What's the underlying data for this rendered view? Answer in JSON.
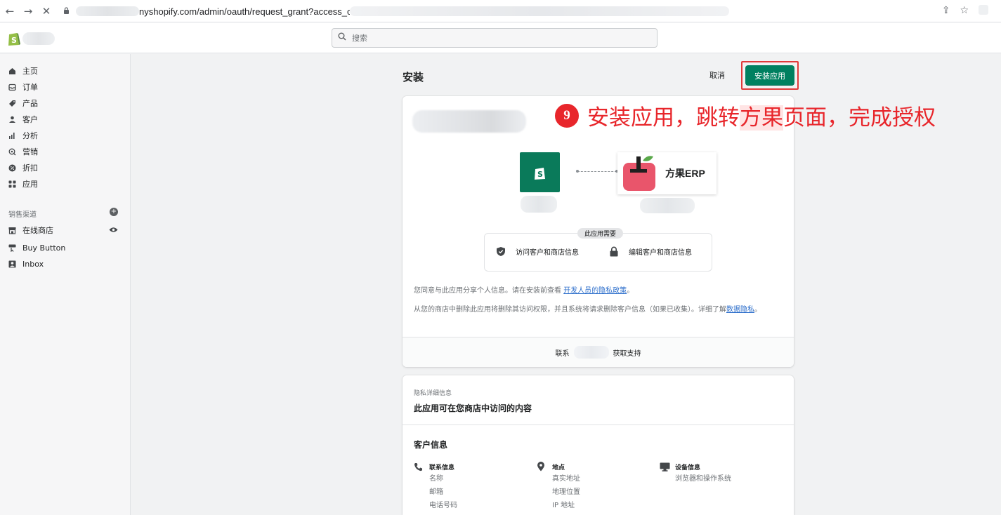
{
  "browser": {
    "url_visible": "nyshopify.com/admin/oauth/request_grant?access_change"
  },
  "topbar": {
    "search_placeholder": "搜索"
  },
  "sidebar": {
    "items": [
      {
        "label": "主页",
        "icon": "home-icon"
      },
      {
        "label": "订单",
        "icon": "inbox-tray-icon"
      },
      {
        "label": "产品",
        "icon": "tag-icon"
      },
      {
        "label": "客户",
        "icon": "person-icon"
      },
      {
        "label": "分析",
        "icon": "bar-chart-icon"
      },
      {
        "label": "营销",
        "icon": "target-icon"
      },
      {
        "label": "折扣",
        "icon": "discount-icon"
      },
      {
        "label": "应用",
        "icon": "apps-icon"
      }
    ],
    "channels_label": "销售渠道",
    "channels": [
      {
        "label": "在线商店",
        "icon": "storefront-icon"
      },
      {
        "label": "Buy Button",
        "icon": "buy-button-icon"
      },
      {
        "label": "Inbox",
        "icon": "inbox-icon"
      }
    ]
  },
  "page": {
    "title": "安装",
    "cancel_label": "取消",
    "install_label": "安装应用"
  },
  "card": {
    "app_tile_name": "方果ERP",
    "requirements_label": "此应用需要",
    "permissions": [
      "访问客户和商店信息",
      "编辑客户和商店信息"
    ],
    "consent_text": "您同意与此应用分享个人信息。请在安装前查看 ",
    "consent_link": "开发人员的隐私政策",
    "consent_end": "。",
    "removal_text": "从您的商店中删除此应用将删除其访问权限，并且系统将请求删除客户信息（如果已收集）。详细了解",
    "removal_link": "数据隐私",
    "removal_end": "。",
    "support_prefix": "联系",
    "support_suffix": "获取支持"
  },
  "privacy": {
    "subtitle": "隐私详细信息",
    "title": "此应用可在您商店中访问的内容",
    "section": "客户信息",
    "columns": [
      {
        "heading": "联系信息",
        "icon": "phone-icon",
        "items": [
          "名称",
          "邮箱",
          "电话号码"
        ]
      },
      {
        "heading": "地点",
        "icon": "location-pin-icon",
        "items": [
          "真实地址",
          "地理位置",
          "IP 地址"
        ]
      },
      {
        "heading": "设备信息",
        "icon": "monitor-icon",
        "items": [
          "浏览器和操作系统"
        ]
      }
    ]
  },
  "annotation": {
    "step": "9",
    "text_a": "安装应用，跳转",
    "text_b": "方果",
    "text_c": "页面，完成授权",
    "color": "#e8262b"
  },
  "colors": {
    "primary": "#008060",
    "link": "#2c6ecb",
    "highlight_border": "#e03a3a"
  }
}
